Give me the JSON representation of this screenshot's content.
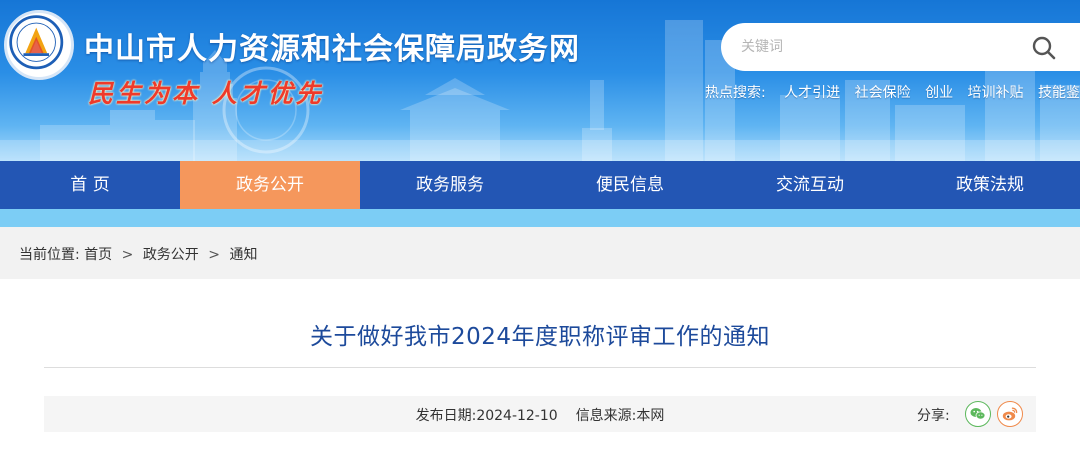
{
  "header": {
    "site_title": "中山市人力资源和社会保障局政务网",
    "slogan": "民生为本 人才优先",
    "search": {
      "placeholder": "关键词"
    },
    "hot_search": {
      "label": "热点搜索:",
      "links": [
        "人才引进",
        "社会保险",
        "创业",
        "培训补贴",
        "技能鉴定"
      ]
    }
  },
  "nav": {
    "items": [
      "首 页",
      "政务公开",
      "政务服务",
      "便民信息",
      "交流互动",
      "政策法规"
    ],
    "active_index": 1
  },
  "breadcrumb": {
    "prefix": "当前位置:",
    "items": [
      "首页",
      "政务公开",
      "通知"
    ],
    "separator": ">"
  },
  "article": {
    "title": "关于做好我市2024年度职称评审工作的通知",
    "publish_label": "发布日期:",
    "publish_date": "2024-12-10",
    "source_label": "信息来源:",
    "source": "本网",
    "share_label": "分享:"
  },
  "colors": {
    "nav_bg": "#2356b4",
    "nav_active": "#f5975c",
    "title_color": "#1d4a9b",
    "slogan_color": "#ef3a2a"
  },
  "icons": [
    "search-icon",
    "wechat-icon",
    "weibo-icon"
  ]
}
